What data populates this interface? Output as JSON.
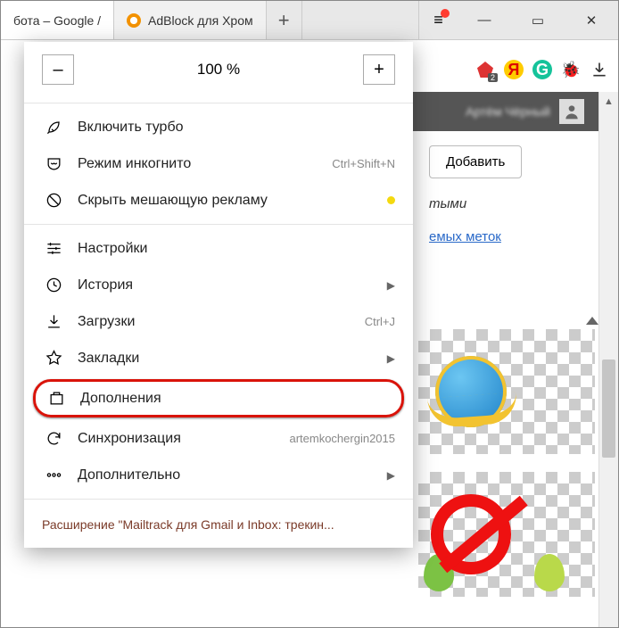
{
  "tabs": [
    {
      "label": "бота – Google /",
      "favicon_color": "#ffffff"
    },
    {
      "label": "AdBlock для Хром",
      "favicon_color": "#f39200"
    }
  ],
  "window_controls": {
    "minimize": "—",
    "maximize": "▭",
    "close": "✕"
  },
  "toolbar_icons": {
    "ext1": "🕑",
    "ext1_badge": "2",
    "yandex": "Я",
    "grammarly": "G",
    "bug": "🐞",
    "download": "⬇"
  },
  "user": {
    "name_blur": "Артём Чёрный"
  },
  "page": {
    "add_button": "Добавить",
    "text1": "тыми",
    "link_partial": "емых меток"
  },
  "zoom": {
    "minus": "–",
    "value": "100 %",
    "plus": "+"
  },
  "menu": {
    "turbo": "Включить турбо",
    "incognito": "Режим инкогнито",
    "incognito_hint": "Ctrl+Shift+N",
    "hide_ads": "Скрыть мешающую рекламу",
    "hide_ads_dot_color": "#f4d90f",
    "settings": "Настройки",
    "history": "История",
    "downloads": "Загрузки",
    "downloads_hint": "Ctrl+J",
    "bookmarks": "Закладки",
    "addons": "Дополнения",
    "sync": "Синхронизация",
    "sync_hint": "artemkochergin2015",
    "more": "Дополнительно"
  },
  "promo": "Расширение \"Mailtrack для Gmail и Inbox: трекин..."
}
